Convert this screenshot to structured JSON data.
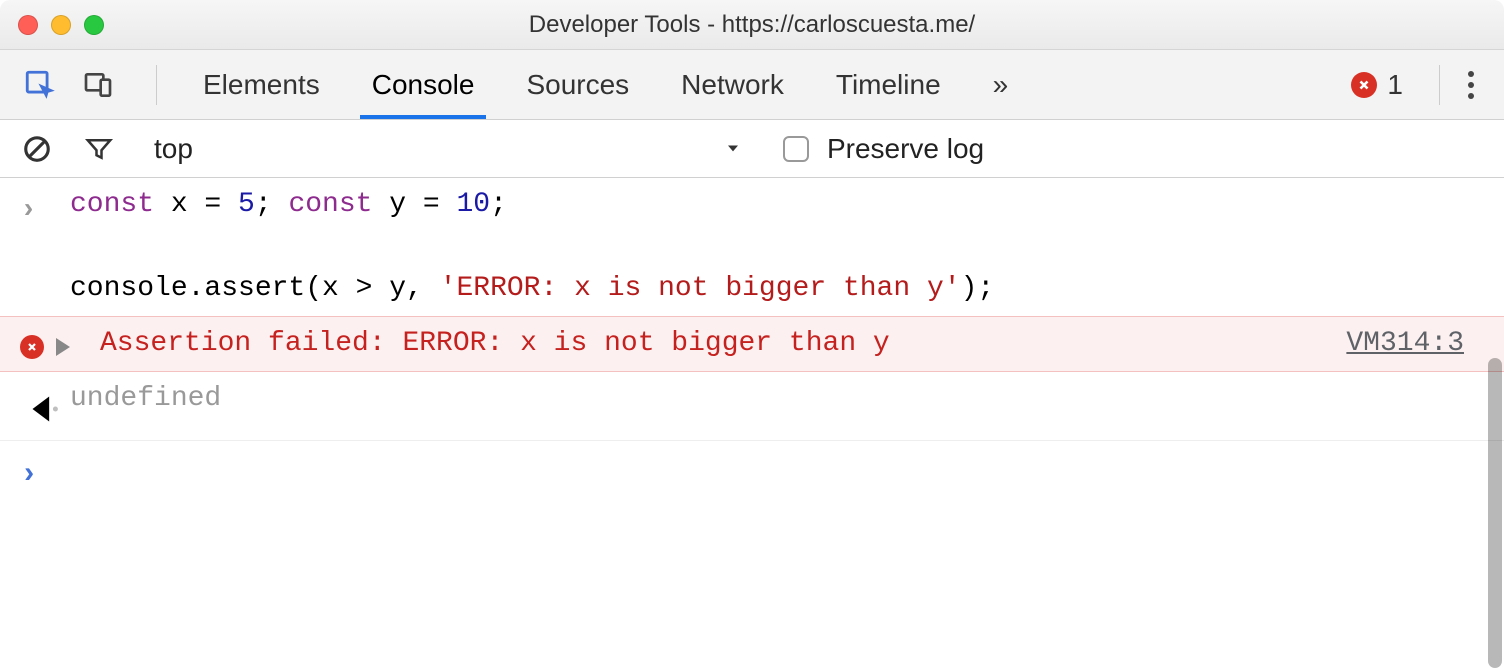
{
  "window": {
    "title": "Developer Tools - https://carloscuesta.me/"
  },
  "toolbar": {
    "tabs": [
      "Elements",
      "Console",
      "Sources",
      "Network",
      "Timeline"
    ],
    "activeTab": "Console",
    "moreTabs": "»",
    "errorCount": "1"
  },
  "subbar": {
    "context": "top",
    "preserveLabel": "Preserve log",
    "preserveChecked": false
  },
  "console": {
    "input": {
      "kw1": "const",
      "t1": " x = ",
      "n1": "5",
      "t2": "; ",
      "kw2": "const",
      "t3": " y = ",
      "n2": "10",
      "t4": ";",
      "blank": "",
      "t5": "console.assert(x > y, ",
      "s1": "'ERROR: x is not bigger than y'",
      "t6": ");"
    },
    "error": {
      "message": "Assertion failed: ERROR: x is not bigger than y",
      "source": "VM314:3"
    },
    "return": "undefined"
  }
}
